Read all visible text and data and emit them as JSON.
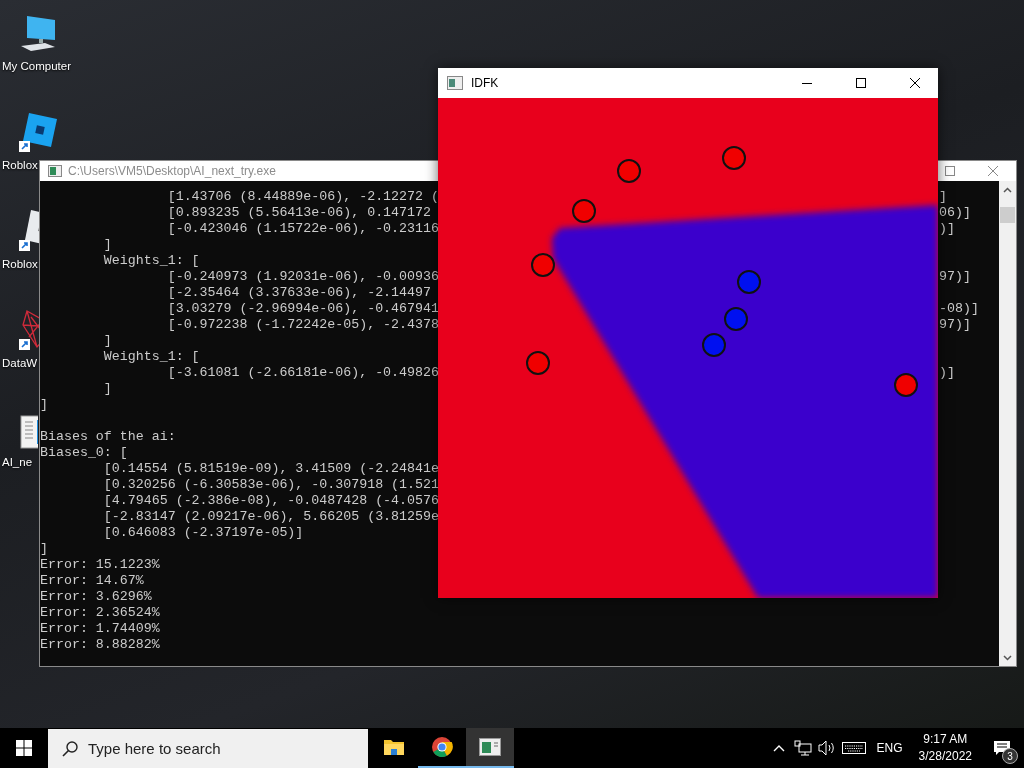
{
  "desktop_icons": [
    {
      "kind": "computer",
      "label": "My Computer"
    },
    {
      "kind": "roblox",
      "label": "Roblox"
    },
    {
      "kind": "roblox-studio",
      "label": "Roblox"
    },
    {
      "kind": "web",
      "label": "DataW"
    },
    {
      "kind": "app",
      "label": "AI_ne"
    }
  ],
  "console_window": {
    "title": "C:\\Users\\VM5\\Desktop\\AI_next_try.exe",
    "lines": [
      {
        "kind": "text",
        "text": "                [1.43706 (8.44889e-06), -2.12272 (",
        "tail": "]"
      },
      {
        "kind": "text",
        "text": "                [0.893235 (5.56413e-06), 0.147172",
        "tail": "06)]"
      },
      {
        "kind": "text",
        "text": "                [-0.423046 (1.15722e-06), -0.23116",
        "tail": ")]"
      },
      {
        "kind": "text",
        "text": "        ]"
      },
      {
        "kind": "text",
        "text": "        Weights_1: ["
      },
      {
        "kind": "text",
        "text": "                [-0.240973 (1.92031e-06), -0.00936",
        "tail": "97)]"
      },
      {
        "kind": "text",
        "text": "                [-2.35464 (3.37633e-06), -2.14497"
      },
      {
        "kind": "text",
        "text": "                [3.03279 (-2.96994e-06), -0.467941",
        "tail": "-08)]"
      },
      {
        "kind": "text",
        "text": "                [-0.972238 (-1.72242e-05), -2.4378",
        "tail": "97)]"
      },
      {
        "kind": "text",
        "text": "        ]"
      },
      {
        "kind": "text",
        "text": "        Weights_1: ["
      },
      {
        "kind": "text",
        "text": "                [-3.61081 (-2.66181e-06), -0.49826",
        "tail": ")]"
      },
      {
        "kind": "text",
        "text": "        ]"
      },
      {
        "kind": "text",
        "text": "]"
      },
      {
        "kind": "blank"
      },
      {
        "kind": "text",
        "text": "Biases of the ai:"
      },
      {
        "kind": "text",
        "text": "Biases_0: ["
      },
      {
        "kind": "text",
        "text": "        [0.14554 (5.81519e-09), 3.41509 (-2.24841e"
      },
      {
        "kind": "text",
        "text": "        [0.320256 (-6.30583e-06), -0.307918 (1.521"
      },
      {
        "kind": "text",
        "text": "        [4.79465 (-2.386e-08), -0.0487428 (-4.0576"
      },
      {
        "kind": "text",
        "text": "        [-2.83147 (2.09217e-06), 5.66205 (3.81259e"
      },
      {
        "kind": "text",
        "text": "        [0.646083 (-2.37197e-05)]"
      },
      {
        "kind": "text",
        "text": "]"
      },
      {
        "kind": "text",
        "text": "Error: 15.1223%"
      },
      {
        "kind": "text",
        "text": "Error: 14.67%"
      },
      {
        "kind": "text",
        "text": "Error: 3.6296%"
      },
      {
        "kind": "text",
        "text": "Error: 2.36524%"
      },
      {
        "kind": "text",
        "text": "Error: 1.74409%"
      },
      {
        "kind": "text",
        "text": "Error: 8.88282%"
      }
    ]
  },
  "plot_window": {
    "title": "IDFK"
  },
  "taskbar": {
    "search": {
      "placeholder": "Type here to search"
    },
    "apps": [
      {
        "kind": "explorer",
        "open": false,
        "active": false
      },
      {
        "kind": "chrome",
        "open": true,
        "active": false
      },
      {
        "kind": "console",
        "open": true,
        "active": true
      }
    ],
    "language": "ENG",
    "time": "9:17 AM",
    "date": "3/28/2022",
    "notification_count": "3"
  }
}
